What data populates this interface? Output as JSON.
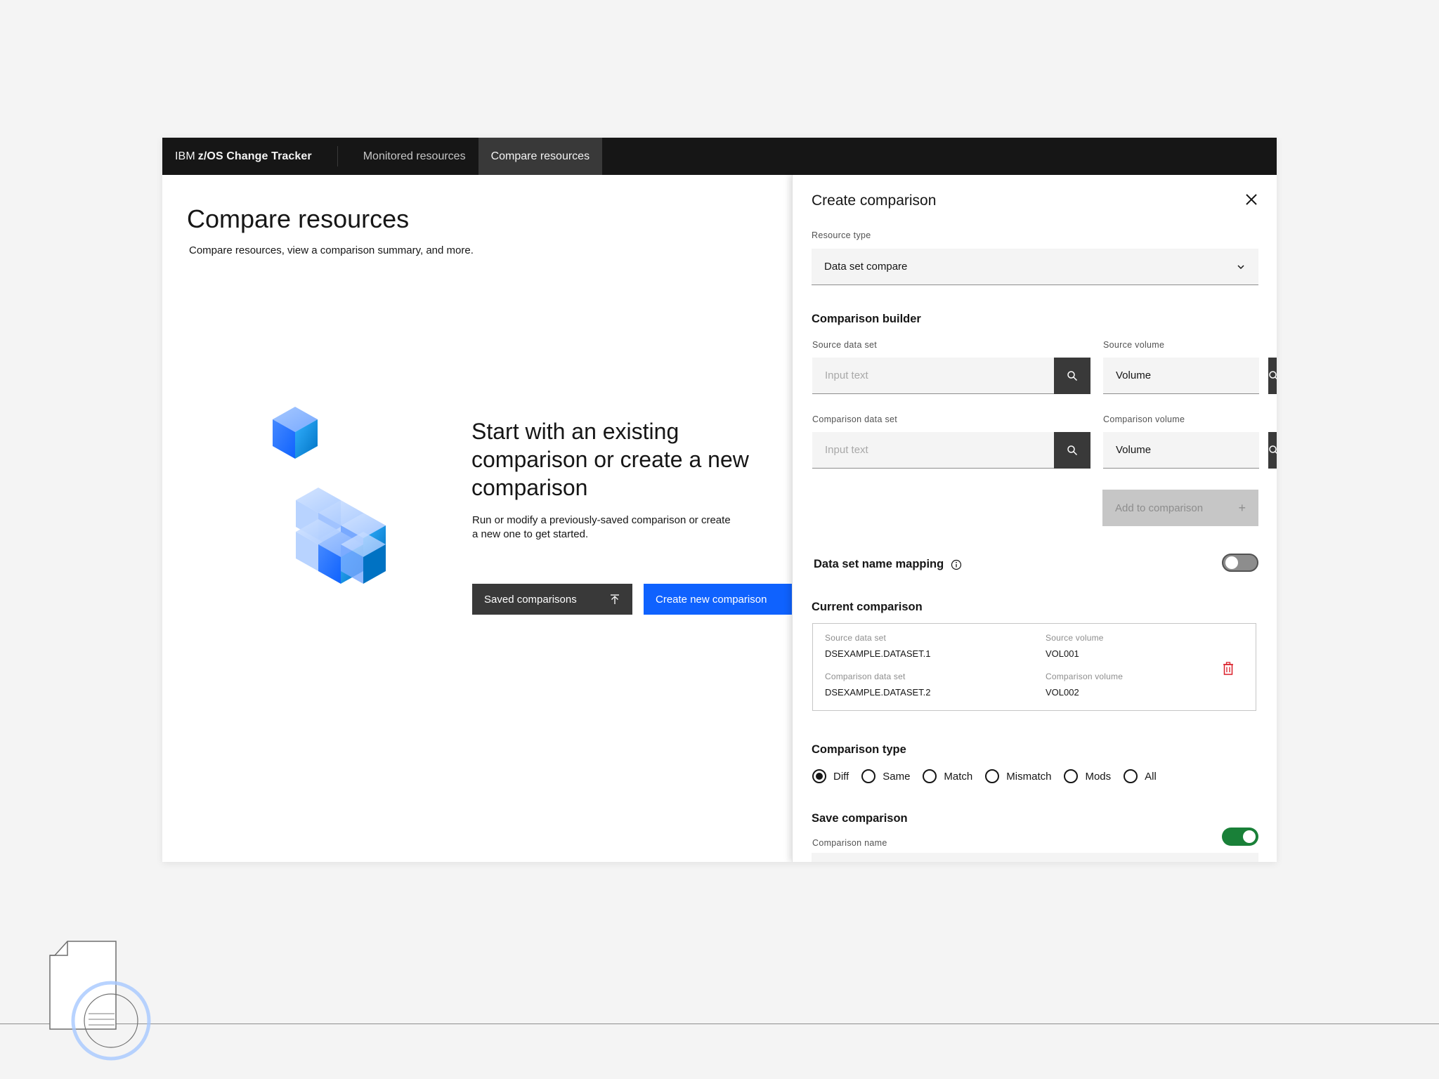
{
  "header": {
    "brand_prefix": "IBM",
    "brand_name": "z/OS Change Tracker",
    "nav": [
      "Monitored resources",
      "Compare resources"
    ]
  },
  "page": {
    "title": "Compare resources",
    "subtitle": "Compare resources, view a comparison summary, and more."
  },
  "empty_state": {
    "title": "Start with an existing comparison or create a new comparison",
    "body": "Run or modify a previously-saved comparison or create a new one to get started.",
    "secondary_button": "Saved comparisons",
    "primary_button": "Create new comparison"
  },
  "panel": {
    "title": "Create comparison",
    "resource_type": {
      "label": "Resource type",
      "value": "Data set compare"
    },
    "builder": {
      "title": "Comparison builder",
      "source_dataset": {
        "label": "Source data set",
        "placeholder": "Input text"
      },
      "source_volume": {
        "label": "Source volume",
        "value": "Volume"
      },
      "comparison_dataset": {
        "label": "Comparison data set",
        "placeholder": "Input text"
      },
      "comparison_volume": {
        "label": "Comparison volume",
        "value": "Volume"
      },
      "add_button": "Add to comparison"
    },
    "mapping": {
      "label": "Data set name mapping",
      "enabled": false
    },
    "current": {
      "title": "Current comparison",
      "source_dataset_label": "Source data set",
      "source_dataset_value": "DSEXAMPLE.DATASET.1",
      "source_volume_label": "Source volume",
      "source_volume_value": "VOL001",
      "comparison_dataset_label": "Comparison data set",
      "comparison_dataset_value": "DSEXAMPLE.DATASET.2",
      "comparison_volume_label": "Comparison volume",
      "comparison_volume_value": "VOL002"
    },
    "comparison_type": {
      "title": "Comparison type",
      "options": [
        "Diff",
        "Same",
        "Match",
        "Mismatch",
        "Mods",
        "All"
      ],
      "selected": "Diff"
    },
    "save": {
      "title": "Save comparison",
      "enabled": true,
      "name_label": "Comparison name"
    }
  },
  "colors": {
    "primary": "#0f62fe",
    "header_bg": "#161616",
    "toggle_on": "#198038",
    "danger": "#da1e28"
  }
}
